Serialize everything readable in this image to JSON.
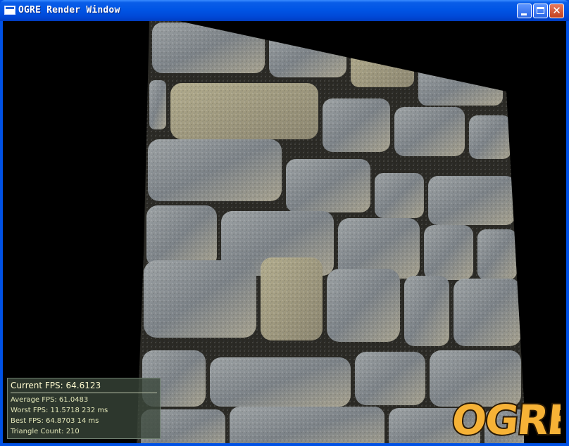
{
  "window": {
    "title": "OGRE Render Window"
  },
  "stats": {
    "current_fps": "Current  FPS:  64.6123",
    "average_fps": "Average  FPS:  61.0483",
    "worst_fps": "Worst  FPS:  11.5718  232  ms",
    "best_fps": "Best  FPS:  64.8703  14  ms",
    "triangle_count": "Triangle  Count:  210"
  },
  "logo": {
    "text": "OGRE"
  },
  "colors": {
    "stone": "#8f949a",
    "mortar": "#2b2a24",
    "logo_fill": "#f6b236",
    "logo_outline": "#2a1a05"
  }
}
